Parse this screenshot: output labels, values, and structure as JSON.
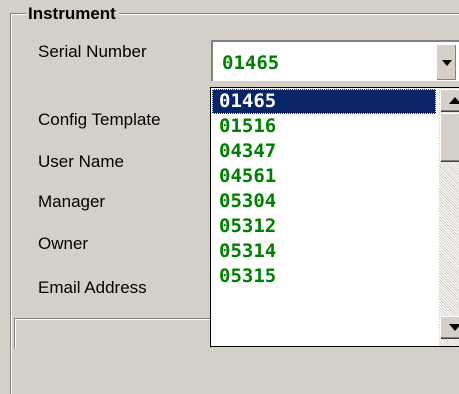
{
  "group": {
    "title": "Instrument"
  },
  "labels": {
    "serial_number": "Serial Number",
    "config_template": "Config Template",
    "user_name": "User Name",
    "manager": "Manager",
    "owner": "Owner",
    "email_address": "Email Address"
  },
  "serial_combo": {
    "value": "01465",
    "options": [
      "01465",
      "01516",
      "04347",
      "04561",
      "05304",
      "05312",
      "05314",
      "05315"
    ],
    "selected_option": "01465"
  },
  "icons": {
    "combo_button": "chevron-down-icon",
    "scroll_up": "scroll-up-arrow-icon",
    "scroll_down": "scroll-down-arrow-icon"
  },
  "colors": {
    "value_text": "#008000",
    "selection_bg": "#0a246a",
    "window_bg": "#d4d0c8"
  }
}
